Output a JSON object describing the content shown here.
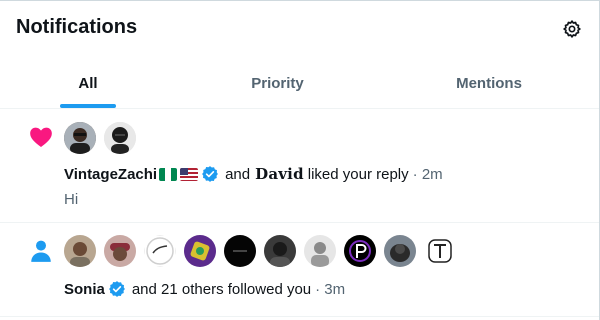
{
  "header": {
    "title": "Notifications",
    "settings_icon": "gear-icon"
  },
  "tabs": [
    {
      "label": "All",
      "active": true
    },
    {
      "label": "Priority",
      "active": false
    },
    {
      "label": "Mentions",
      "active": false
    }
  ],
  "colors": {
    "accent": "#1d9bf0",
    "like": "#f91880",
    "muted": "#536471",
    "text": "#0f1419",
    "verified": "#1d9bf0"
  },
  "notifications": [
    {
      "type_icon": "heart-icon",
      "avatar_count": 2,
      "actor1": "VintageZachi",
      "actor1_flags": [
        "nigeria-flag",
        "usa-flag"
      ],
      "actor1_verified": true,
      "connector": "and",
      "actor2": "𝐃𝐚𝐯𝐢𝐝",
      "action": "liked your reply",
      "time": "· 2m",
      "snippet": "Hi"
    },
    {
      "type_icon": "person-icon",
      "avatar_count": 10,
      "actor1": "Sonia",
      "actor1_verified": true,
      "action": "and 21 others followed you",
      "time": "· 3m"
    }
  ]
}
